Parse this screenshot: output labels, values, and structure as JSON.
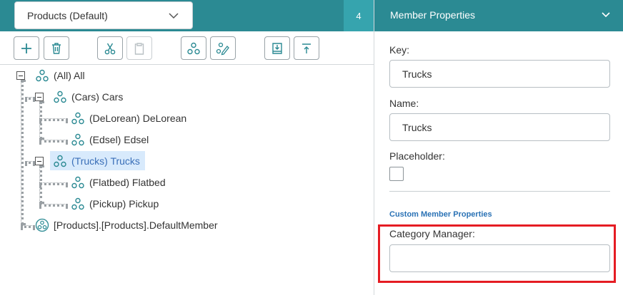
{
  "left_header": {
    "dimension_select": "Products (Default)",
    "count": "4"
  },
  "toolbar": {
    "buttons": [
      {
        "icon": "plus-icon"
      },
      {
        "icon": "trash-icon"
      },
      {
        "icon": "scissors-icon"
      },
      {
        "icon": "clipboard-icon"
      },
      {
        "icon": "hierarchy-icon"
      },
      {
        "icon": "hierarchy-edit-icon"
      },
      {
        "icon": "import-icon"
      },
      {
        "icon": "export-icon"
      }
    ]
  },
  "tree": {
    "nodes": [
      {
        "label": "(All) All",
        "level": 0,
        "expanded": true,
        "selected": false
      },
      {
        "label": "(Cars) Cars",
        "level": 1,
        "expanded": true,
        "selected": false
      },
      {
        "label": "(DeLorean) DeLorean",
        "level": 2,
        "selected": false
      },
      {
        "label": "(Edsel) Edsel",
        "level": 2,
        "selected": false
      },
      {
        "label": "(Trucks) Trucks",
        "level": 1,
        "expanded": true,
        "selected": true
      },
      {
        "label": "(Flatbed) Flatbed",
        "level": 2,
        "selected": false
      },
      {
        "label": "(Pickup) Pickup",
        "level": 2,
        "selected": false
      },
      {
        "label": "[Products].[Products].DefaultMember",
        "level": 0,
        "selected": false
      }
    ]
  },
  "member_properties": {
    "title": "Member Properties",
    "key_label": "Key:",
    "key_value": "Trucks",
    "name_label": "Name:",
    "name_value": "Trucks",
    "placeholder_label": "Placeholder:",
    "placeholder_checked": false,
    "custom_section_title": "Custom Member Properties",
    "category_manager_label": "Category Manager:",
    "category_manager_value": ""
  },
  "colors": {
    "header_teal": "#2b8a93",
    "badge_teal": "#36a4ae",
    "icon_teal": "#2b8a93",
    "selected_row": "#d8eafc",
    "section_title_blue": "#2a72b5",
    "highlight_red": "#e51c23"
  }
}
